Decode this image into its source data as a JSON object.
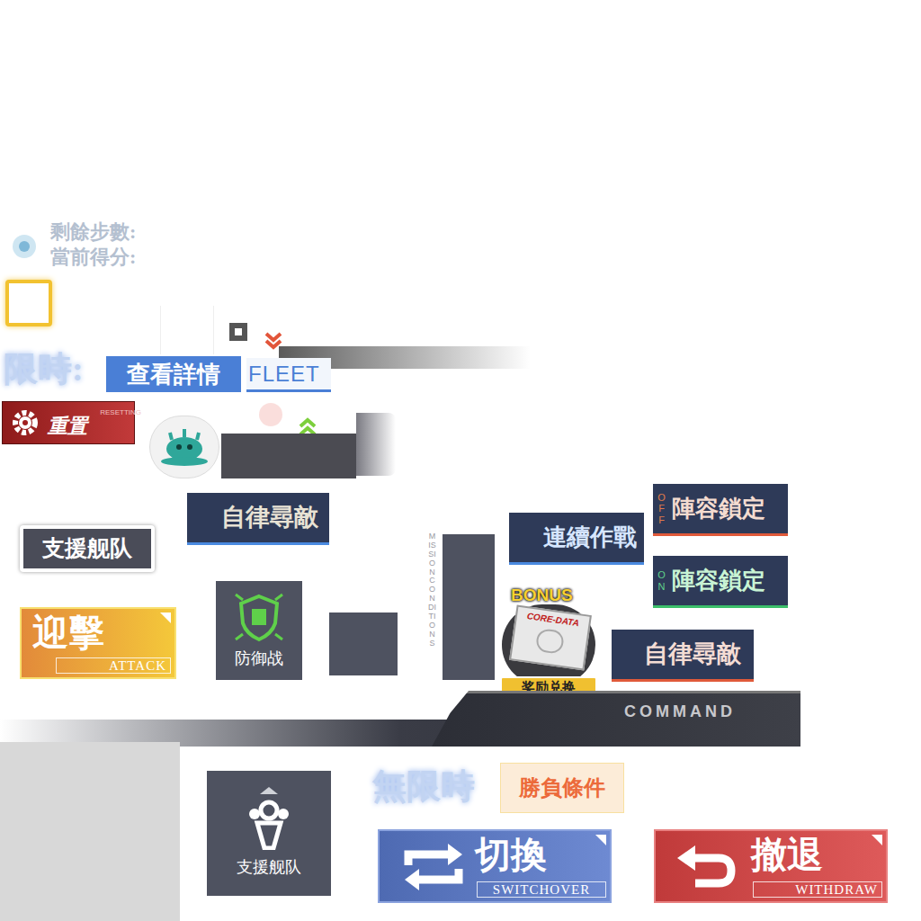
{
  "status_panel": {
    "steps_label": "剩餘步數:",
    "score_label": "當前得分:"
  },
  "timer": {
    "limited": "限時:",
    "unlimited": "無限時"
  },
  "details_button": "查看詳情",
  "fleet_tab": "FLEET",
  "reset_button": {
    "label": "重置",
    "sublabel": "RESETTING"
  },
  "auto_search_buttons": [
    {
      "label": "自律尋敵"
    },
    {
      "label": "自律尋敵"
    }
  ],
  "support_fleet": [
    {
      "label": "支援舰队"
    },
    {
      "label": "支援舰队"
    }
  ],
  "attack_button": {
    "label": "迎擊",
    "sublabel": "ATTACK"
  },
  "defense_badge": "防御战",
  "mission_conditions": "MISSION CONDITIONS",
  "continuous_battle": "連續作戰",
  "formation_lock": [
    {
      "state_label": "OFF",
      "label": "陣容鎖定",
      "on": false
    },
    {
      "state_label": "ON",
      "label": "陣容鎖定",
      "on": true
    }
  ],
  "bonus": {
    "badge": "BONUS",
    "card": "CORE-DATA",
    "label": "奖励兑换"
  },
  "command_bar": "COMMAND",
  "victory_conditions": "勝負條件",
  "switch_button": {
    "label": "切換",
    "sublabel": "SWITCHOVER"
  },
  "withdraw_button": {
    "label": "撤退",
    "sublabel": "WITHDRAW"
  }
}
